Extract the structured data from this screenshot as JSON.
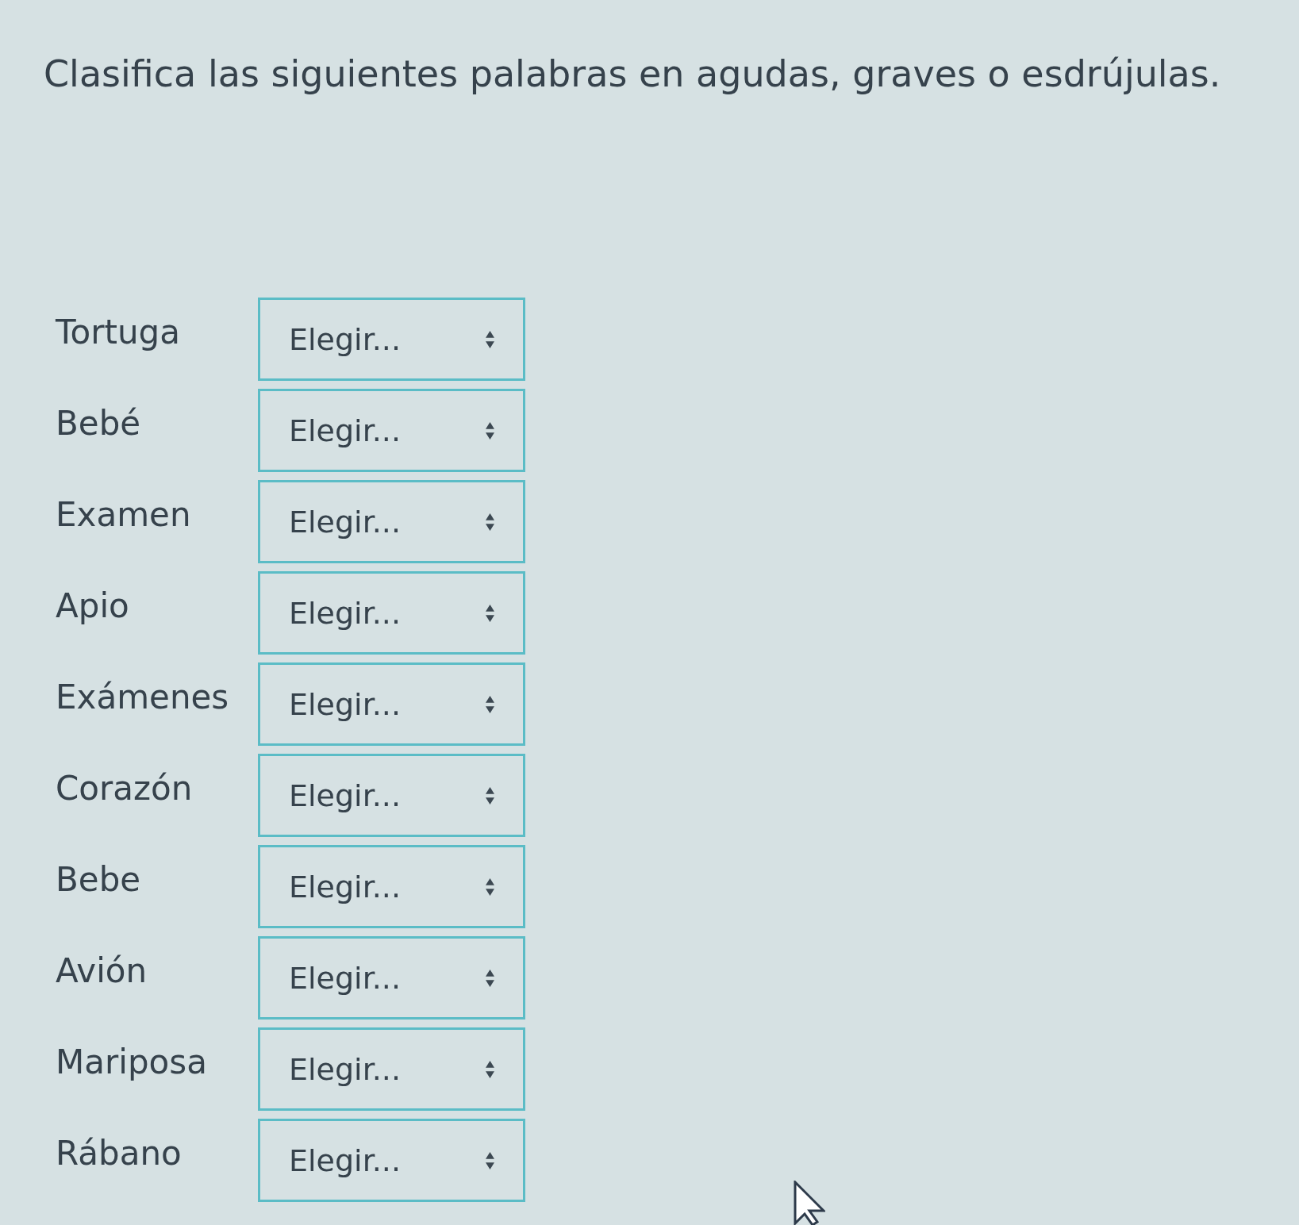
{
  "instruction": "Clasifica las siguientes palabras en agudas, graves o esdrújulas.",
  "items": [
    {
      "word": "Tortuga",
      "select": {
        "value": "Elegir..."
      }
    },
    {
      "word": "Bebé",
      "select": {
        "value": "Elegir..."
      }
    },
    {
      "word": "Examen",
      "select": {
        "value": "Elegir..."
      }
    },
    {
      "word": "Apio",
      "select": {
        "value": "Elegir..."
      }
    },
    {
      "word": "Exámenes",
      "select": {
        "value": "Elegir..."
      }
    },
    {
      "word": "Corazón",
      "select": {
        "value": "Elegir..."
      }
    },
    {
      "word": "Bebe",
      "select": {
        "value": "Elegir..."
      }
    },
    {
      "word": "Avión",
      "select": {
        "value": "Elegir..."
      }
    },
    {
      "word": "Mariposa",
      "select": {
        "value": "Elegir..."
      }
    },
    {
      "word": "Rábano",
      "select": {
        "value": "Elegir..."
      }
    }
  ]
}
